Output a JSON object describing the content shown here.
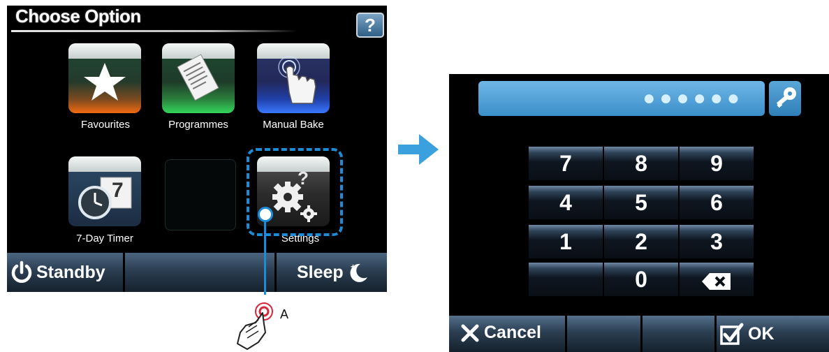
{
  "left_screen": {
    "title": "Choose Option",
    "help_label": "?",
    "tiles": [
      {
        "label": "Favourites",
        "icon": "star-icon"
      },
      {
        "label": "Programmes",
        "icon": "document-icon"
      },
      {
        "label": "Manual Bake",
        "icon": "touch-hand-icon"
      },
      {
        "label": "7-Day Timer",
        "icon": "clock-calendar-icon",
        "calendar_day": "7"
      },
      {
        "label": "",
        "icon": ""
      },
      {
        "label": "Settings",
        "icon": "gears-icon"
      }
    ],
    "bottom_bar": {
      "standby_label": "Standby",
      "sleep_label": "Sleep"
    }
  },
  "annotation": {
    "label": "A"
  },
  "right_screen": {
    "pin_display": "●●●●●●",
    "keypad": [
      "7",
      "8",
      "9",
      "4",
      "5",
      "6",
      "1",
      "2",
      "3",
      "",
      "0",
      "backspace"
    ],
    "bottom_bar": {
      "cancel_label": "Cancel",
      "ok_label": "OK"
    }
  },
  "colors": {
    "accent": "#1e8bd6",
    "pin_field": "#4fa3db"
  }
}
